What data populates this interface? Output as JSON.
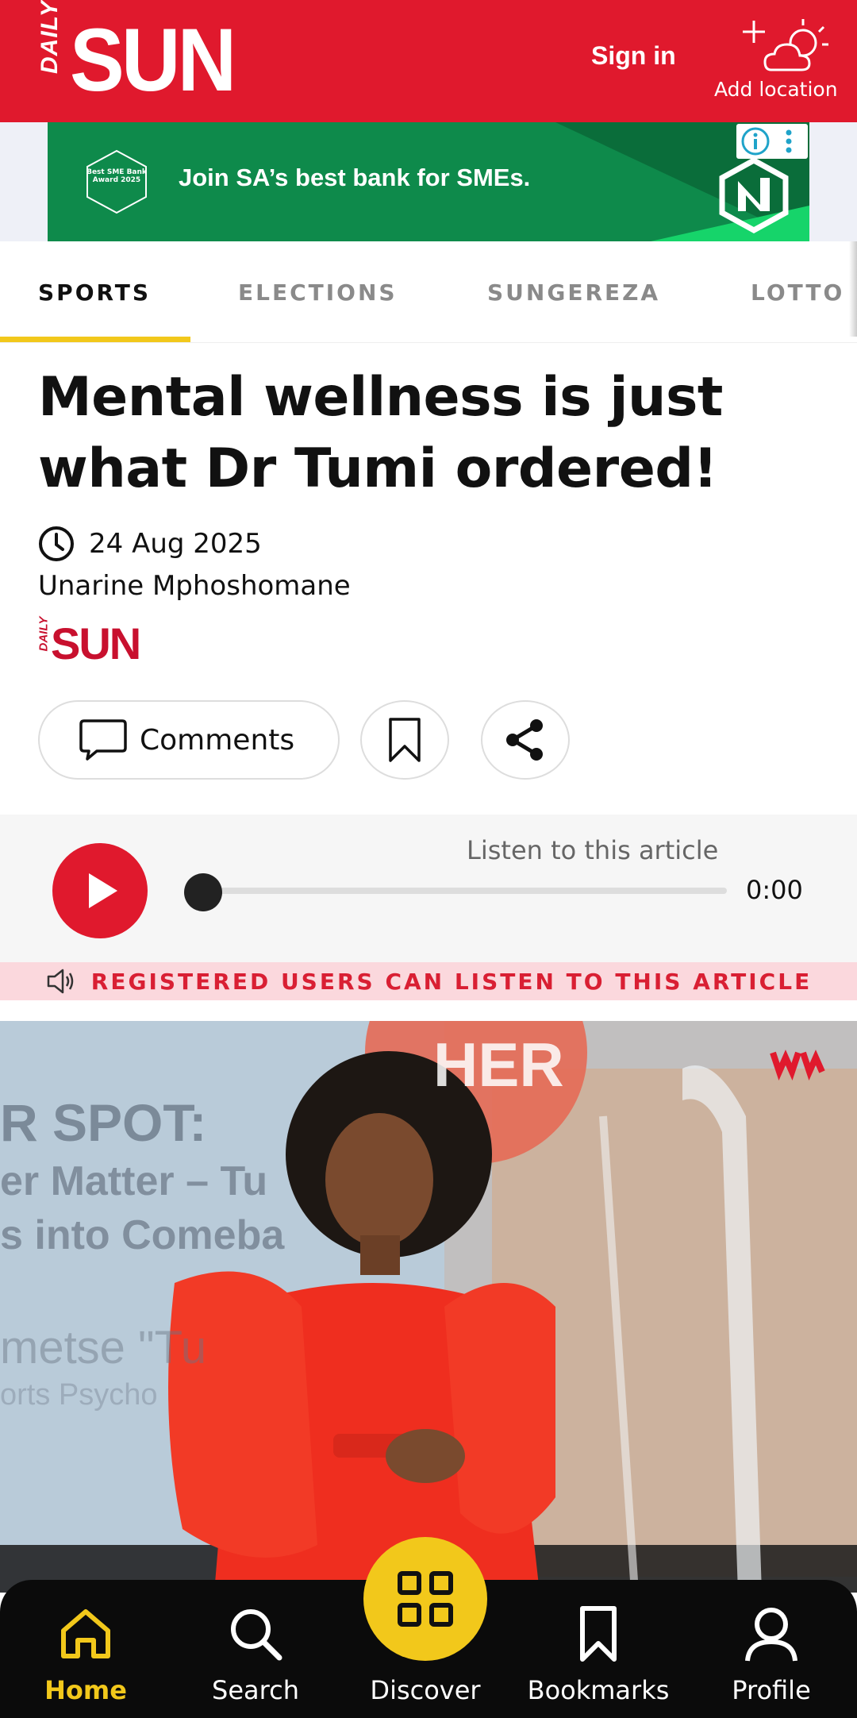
{
  "header": {
    "logo_small": "DAILY",
    "logo_main": "SUN",
    "sign_in": "Sign in",
    "add_location": "Add location"
  },
  "ad": {
    "badge_text": "Best SME Bank Award 2025",
    "headline": "Join SA’s best bank for SMEs.",
    "info_icon": "info-icon",
    "menu_icon": "more-vertical-icon"
  },
  "tabs": [
    {
      "label": "SPORTS",
      "active": true
    },
    {
      "label": "ELECTIONS",
      "active": false
    },
    {
      "label": "SUNGEREZA",
      "active": false
    },
    {
      "label": "LOTTO",
      "active": false
    }
  ],
  "article": {
    "title": "Mental wellness is just what Dr Tumi ordered!",
    "date": "24 Aug 2025",
    "author": "Unarine Mphoshomane",
    "source_small": "DAILY",
    "source_main": "SUN"
  },
  "actions": {
    "comments": "Comments"
  },
  "audio": {
    "label": "Listen to this article",
    "time": "0:00",
    "progress": 0,
    "registered_notice": "REGISTERED USERS CAN LISTEN TO THIS ARTICLE"
  },
  "hero": {
    "sign_her": "HER",
    "banner_line1": "R SPOT:",
    "banner_line2": "er Matter – Tu",
    "banner_line3": "s into Comeba",
    "banner_line4": "metse \"Tu",
    "banner_line5": "orts Psycho"
  },
  "bottom_nav": [
    {
      "label": "Home",
      "icon": "home-icon",
      "active": true
    },
    {
      "label": "Search",
      "icon": "search-icon",
      "active": false
    },
    {
      "label": "Discover",
      "icon": "grid-icon",
      "active": false
    },
    {
      "label": "Bookmarks",
      "icon": "bookmark-icon",
      "active": false
    },
    {
      "label": "Profile",
      "icon": "user-icon",
      "active": false
    }
  ],
  "colors": {
    "brand_red": "#e0192d",
    "accent_yellow": "#f2c81b",
    "ad_green": "#0e8a4b"
  }
}
